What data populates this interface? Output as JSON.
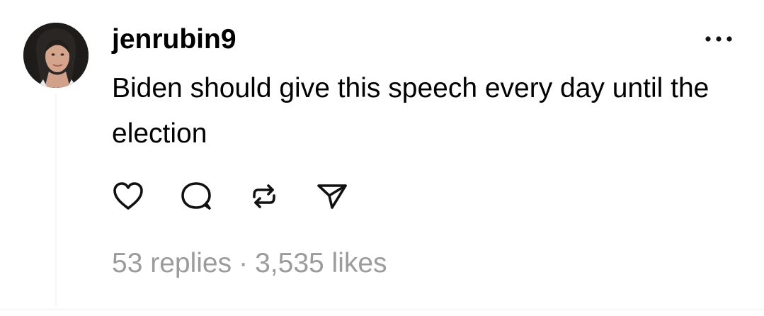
{
  "post": {
    "author": {
      "username": "jenrubin9",
      "avatar_icon": "profile-photo"
    },
    "text": "Biden should give this speech every day until the election",
    "actions": {
      "like_icon": "heart-icon",
      "reply_icon": "comment-icon",
      "repost_icon": "repost-icon",
      "share_icon": "send-icon"
    },
    "stats": {
      "replies": "53 replies",
      "separator": "·",
      "likes": "3,535 likes"
    },
    "menu_icon": "more-icon"
  },
  "colors": {
    "text": "#000000",
    "muted": "#9b9b9b",
    "background": "#ffffff"
  }
}
